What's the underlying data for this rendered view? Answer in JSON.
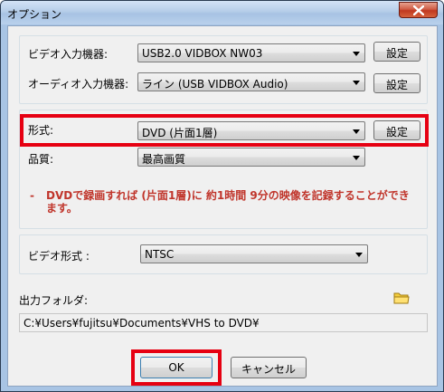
{
  "window": {
    "title": "オプション"
  },
  "devices": {
    "video_label": "ビデオ入力機器:",
    "video_value": "USB2.0 VIDBOX NW03",
    "video_settings": "設定",
    "audio_label": "オーディオ入力機器:",
    "audio_value": "ライン (USB VIDBOX Audio)",
    "audio_settings": "設定"
  },
  "format": {
    "label": "形式:",
    "value": "DVD (片面1層)",
    "settings": "設定",
    "quality_label": "品質:",
    "quality_value": "最高画質",
    "note_dash": "-",
    "note": "DVDで録画すれば (片面1層)に 約1時間 9分の映像を記録することができます。"
  },
  "video_format": {
    "label": "ビデオ形式 :",
    "value": "NTSC"
  },
  "output": {
    "label": "出力フォルダ:",
    "path": "C:¥Users¥fujitsu¥Documents¥VHS to DVD¥"
  },
  "buttons": {
    "ok": "OK",
    "cancel": "キャンセル"
  },
  "colors": {
    "highlight": "#e60012",
    "note_text": "#c0352b",
    "titlebar": "#b5cde9"
  }
}
